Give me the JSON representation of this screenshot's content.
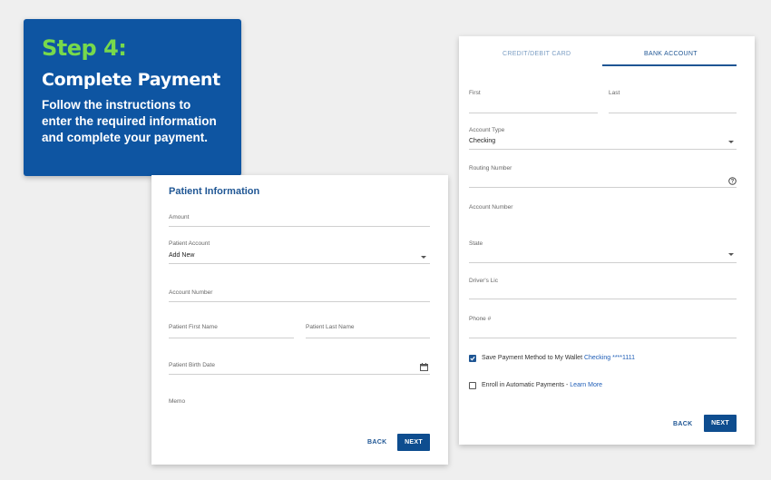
{
  "step": {
    "number": "Step 4:",
    "title": "Complete Payment",
    "description": "Follow the instructions to enter the required information and complete your payment."
  },
  "patient_form": {
    "title": "Patient Information",
    "amount_label": "Amount",
    "patient_account_label": "Patient Account",
    "patient_account_value": "Add New",
    "account_number_label": "Account Number",
    "first_name_label": "Patient First Name",
    "last_name_label": "Patient Last Name",
    "birth_date_label": "Patient Birth Date",
    "memo_label": "Memo",
    "back_label": "BACK",
    "next_label": "NEXT"
  },
  "payment_form": {
    "tabs": [
      {
        "label": "CREDIT/DEBIT CARD",
        "active": false
      },
      {
        "label": "BANK ACCOUNT",
        "active": true
      }
    ],
    "first_label": "First",
    "last_label": "Last",
    "account_type_label": "Account Type",
    "account_type_value": "Checking",
    "routing_number_label": "Routing Number",
    "account_number_label": "Account Number",
    "state_label": "State",
    "drivers_lic_label": "Driver's Lic",
    "phone_label": "Phone #",
    "save_wallet_text": "Save Payment Method to My Wallet",
    "save_wallet_link": "Checking ****1111",
    "save_wallet_checked": true,
    "enroll_text": "Enroll in Automatic Payments -",
    "enroll_link": "Learn More",
    "enroll_checked": false,
    "back_label": "BACK",
    "next_label": "NEXT"
  },
  "colors": {
    "step_bg": "#0e55a2",
    "step_accent": "#77d94c",
    "primary": "#1f5694",
    "button": "#0e4d8f",
    "link": "#1f5eb7",
    "page_bg": "#efefef"
  }
}
